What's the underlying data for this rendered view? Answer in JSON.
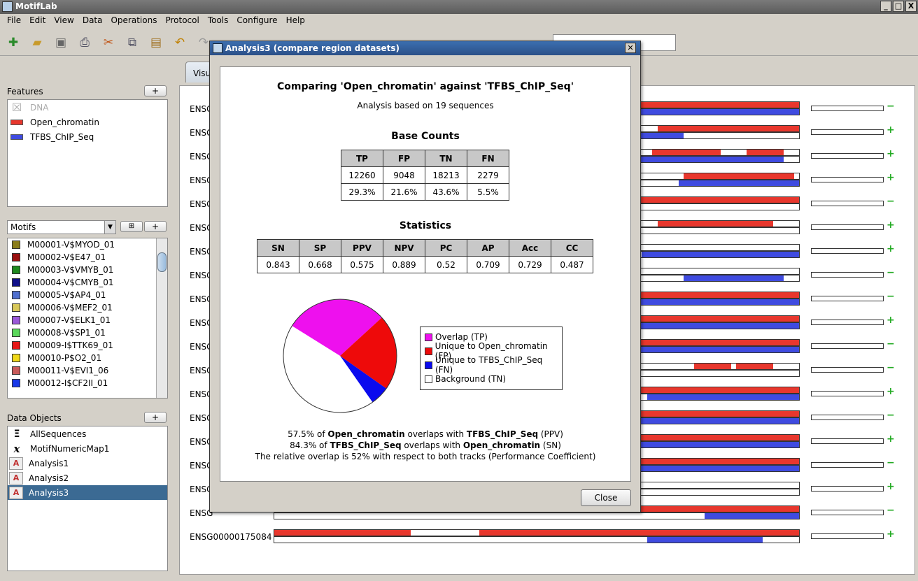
{
  "app": {
    "title": "MotifLab",
    "controls": [
      "_",
      "□",
      "X"
    ]
  },
  "menu": [
    "File",
    "Edit",
    "View",
    "Data",
    "Operations",
    "Protocol",
    "Tools",
    "Configure",
    "Help"
  ],
  "features": {
    "title": "Features",
    "add": "+",
    "items": [
      {
        "label": "DNA",
        "disabled": true
      },
      {
        "label": "Open_chromatin"
      },
      {
        "label": "TFBS_ChIP_Seq"
      }
    ]
  },
  "motifs": {
    "dropdown": "Motifs",
    "add": "+",
    "items": [
      {
        "label": "M00001-V$MYOD_01",
        "color": "#8b7d1a"
      },
      {
        "label": "M00002-V$E47_01",
        "color": "#9b1010"
      },
      {
        "label": "M00003-V$VMYB_01",
        "color": "#1f8a1f"
      },
      {
        "label": "M00004-V$CMYB_01",
        "color": "#10108a"
      },
      {
        "label": "M00005-V$AP4_01",
        "color": "#4f6fd0"
      },
      {
        "label": "M00006-V$MEF2_01",
        "color": "#d8c85a"
      },
      {
        "label": "M00007-V$ELK1_01",
        "color": "#9a58d8"
      },
      {
        "label": "M00008-V$SP1_01",
        "color": "#5ad85a"
      },
      {
        "label": "M00009-I$TTK69_01",
        "color": "#e81818"
      },
      {
        "label": "M00010-P$O2_01",
        "color": "#f0d818"
      },
      {
        "label": "M00011-V$EVI1_06",
        "color": "#c85a5a"
      },
      {
        "label": "M00012-I$CF2II_01",
        "color": "#1838e8"
      }
    ]
  },
  "data_objects": {
    "title": "Data Objects",
    "add": "+",
    "items": [
      {
        "label": "AllSequences",
        "icon": "Ξ"
      },
      {
        "label": "MotifNumericMap1",
        "icon": "x"
      },
      {
        "label": "Analysis1",
        "icon": "A"
      },
      {
        "label": "Analysis2",
        "icon": "A"
      },
      {
        "label": "Analysis3",
        "icon": "A",
        "selected": true
      }
    ]
  },
  "tab_label": "Visu",
  "sequences": [
    {
      "label": "ENSG",
      "red": [
        [
          0.1,
          0.2
        ],
        [
          0.5,
          1.0
        ]
      ],
      "blue": [
        [
          0,
          0.45
        ],
        [
          0,
          1.0
        ]
      ],
      "sign": "−"
    },
    {
      "label": "ENSG",
      "red": [
        [
          0.57,
          0.62
        ],
        [
          0.73,
          1.0
        ]
      ],
      "blue": [
        [
          0.65,
          0.78
        ]
      ],
      "sign": "+"
    },
    {
      "label": "ENSG",
      "red": [
        [
          0.72,
          0.85
        ],
        [
          0.9,
          0.97
        ]
      ],
      "blue": [
        [
          0.0,
          0.97
        ]
      ],
      "sign": "+"
    },
    {
      "label": "ENSG",
      "red": [
        [
          0.78,
          0.99
        ]
      ],
      "blue": [
        [
          0.77,
          1.0
        ]
      ],
      "sign": "+"
    },
    {
      "label": "ENSG",
      "red": [
        [
          0.0,
          1.0
        ]
      ],
      "blue": [],
      "sign": "−"
    },
    {
      "label": "ENSG",
      "red": [
        [
          0.73,
          0.95
        ]
      ],
      "blue": [],
      "sign": "+"
    },
    {
      "label": "ENSG",
      "red": [],
      "blue": [
        [
          0.7,
          1.0
        ]
      ],
      "sign": "+"
    },
    {
      "label": "ENSG",
      "red": [],
      "blue": [
        [
          0.78,
          0.97
        ]
      ],
      "sign": "−"
    },
    {
      "label": "ENSG",
      "red": [
        [
          0.0,
          1.0
        ]
      ],
      "blue": [
        [
          0.0,
          1.0
        ]
      ],
      "sign": "−"
    },
    {
      "label": "ENSG",
      "red": [
        [
          0.0,
          1.0
        ]
      ],
      "blue": [
        [
          0.0,
          1.0
        ]
      ],
      "sign": "+"
    },
    {
      "label": "ENSG",
      "red": [
        [
          0.0,
          1.0
        ]
      ],
      "blue": [
        [
          0.0,
          1.0
        ]
      ],
      "sign": "−"
    },
    {
      "label": "ENSG",
      "red": [
        [
          0.8,
          0.87
        ],
        [
          0.88,
          0.95
        ]
      ],
      "blue": [],
      "sign": "−"
    },
    {
      "label": "ENSG",
      "red": [
        [
          0.0,
          1.0
        ]
      ],
      "blue": [
        [
          0.71,
          1.0
        ]
      ],
      "sign": "+"
    },
    {
      "label": "ENSG",
      "red": [
        [
          0.0,
          1.0
        ]
      ],
      "blue": [
        [
          0.0,
          1.0
        ]
      ],
      "sign": "−"
    },
    {
      "label": "ENSG",
      "red": [
        [
          0.0,
          1.0
        ]
      ],
      "blue": [
        [
          0.0,
          1.0
        ]
      ],
      "sign": "+"
    },
    {
      "label": "ENSG",
      "red": [
        [
          0.0,
          1.0
        ]
      ],
      "blue": [
        [
          0.69,
          1.0
        ]
      ],
      "sign": "−"
    },
    {
      "label": "ENSG",
      "red": [],
      "blue": [],
      "sign": "+"
    },
    {
      "label": "ENSG",
      "red": [
        [
          0.0,
          1.0
        ]
      ],
      "blue": [
        [
          0.82,
          1.0
        ]
      ],
      "sign": "−"
    },
    {
      "label": "ENSG00000175084",
      "red": [
        [
          0.0,
          0.26
        ],
        [
          0.39,
          1.0
        ]
      ],
      "blue": [
        [
          0.71,
          0.93
        ]
      ],
      "sign": "+"
    }
  ],
  "dialog": {
    "title": "Analysis3  (compare region datasets)",
    "heading": "Comparing 'Open_chromatin' against 'TFBS_ChIP_Seq'",
    "subheading": "Analysis based on 19 sequences",
    "base_counts_title": "Base Counts",
    "base_counts": {
      "headers": [
        "TP",
        "FP",
        "TN",
        "FN"
      ],
      "counts": [
        "12260",
        "9048",
        "18213",
        "2279"
      ],
      "percents": [
        "29.3%",
        "21.6%",
        "43.6%",
        "5.5%"
      ]
    },
    "statistics_title": "Statistics",
    "statistics": {
      "headers": [
        "SN",
        "SP",
        "PPV",
        "NPV",
        "PC",
        "AP",
        "Acc",
        "CC"
      ],
      "values": [
        "0.843",
        "0.668",
        "0.575",
        "0.889",
        "0.52",
        "0.709",
        "0.729",
        "0.487"
      ]
    },
    "pie": [
      {
        "label": "Overlap (TP)",
        "value": 29.3,
        "color": "#ee10ee"
      },
      {
        "label": "Unique to Open_chromatin (FP)",
        "value": 21.6,
        "color": "#ee0a0a"
      },
      {
        "label": "Unique to TFBS_ChIP_Seq (FN)",
        "value": 5.5,
        "color": "#0a0aee"
      },
      {
        "label": "Background (TN)",
        "value": 43.6,
        "color": "#ffffff"
      }
    ],
    "summary": [
      {
        "pre": "57.5% of ",
        "a": "Open_chromatin",
        "mid": " overlaps with ",
        "b": "TFBS_ChIP_Seq",
        "post": " (PPV)"
      },
      {
        "pre": "84.3% of ",
        "a": "TFBS_ChIP_Seq",
        "mid": " overlaps with ",
        "b": "Open_chromatin",
        "post": " (SN)"
      },
      {
        "pre": "The relative overlap is 52% with respect to both tracks (Performance Coefficient)",
        "a": "",
        "mid": "",
        "b": "",
        "post": ""
      }
    ],
    "close_label": "Close"
  }
}
